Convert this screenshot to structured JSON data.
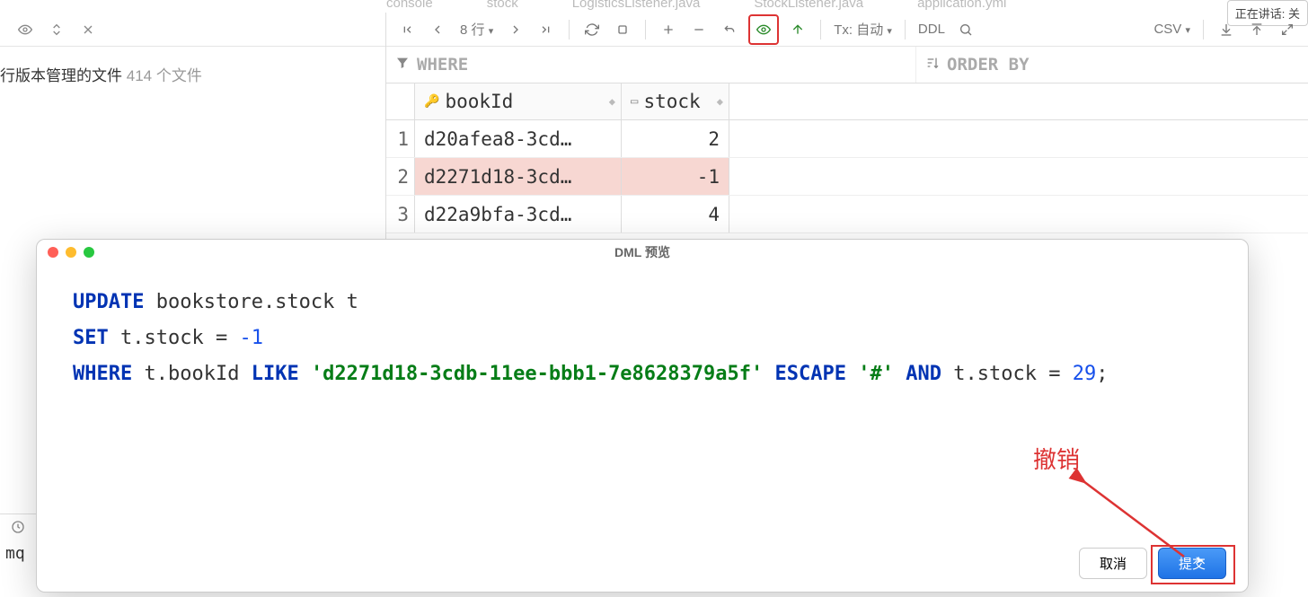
{
  "talk_badge": "正在讲话: 关",
  "top_tabs": [
    "console",
    "stock",
    "LogisticsListener.java",
    "StockListener.java",
    "application.yml"
  ],
  "sidebar": {
    "file_line": "行版本管理的文件",
    "file_count": "414 个文件"
  },
  "toolbar": {
    "row_label": "8 行",
    "tx_label": "Tx: 自动",
    "ddl_label": "DDL",
    "csv_label": "CSV"
  },
  "filter": {
    "where_label": "WHERE",
    "orderby_label": "ORDER BY"
  },
  "grid": {
    "columns": [
      "bookId",
      "stock"
    ],
    "rows": [
      {
        "n": "1",
        "bookId": "d20afea8-3cd…",
        "stock": "2",
        "modified": false
      },
      {
        "n": "2",
        "bookId": "d2271d18-3cd…",
        "stock": "-1",
        "modified": true
      },
      {
        "n": "3",
        "bookId": "d22a9bfa-3cd…",
        "stock": "4",
        "modified": false
      }
    ]
  },
  "modal": {
    "title": "DML 预览",
    "sql": {
      "update_kw": "UPDATE",
      "table": "bookstore.stock t",
      "set_kw": "SET",
      "set_expr_l": "t.stock = ",
      "set_expr_v": "-1",
      "where_kw": "WHERE",
      "where_l": "t.bookId ",
      "like_kw": "LIKE",
      "uuid": "'d2271d18-3cdb-11ee-bbb1-7e8628379a5f'",
      "escape_kw": "ESCAPE",
      "hash": "'#'",
      "and_kw": "AND",
      "tail_l": " t.stock = ",
      "tail_v": "29",
      "semi": ";"
    },
    "cancel": "取消",
    "submit": "提交"
  },
  "annotation": "撤销",
  "bottom": {
    "mq": "mq"
  }
}
